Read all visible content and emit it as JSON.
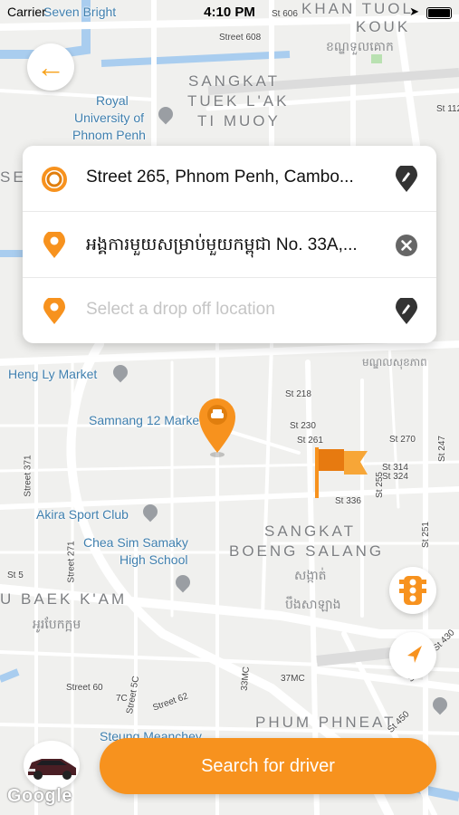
{
  "status_bar": {
    "carrier": "Carrier",
    "time": "4:10 PM"
  },
  "map": {
    "labels": {
      "seven_bright": "Seven Bright",
      "royal_university_line1": "Royal",
      "royal_university_line2": "University of",
      "royal_university_line3": "Phnom Penh",
      "heng_ly_market": "Heng Ly Market",
      "samnang_market": "Samnang 12 Market",
      "akira_sport_club": "Akira Sport Club",
      "chea_sim_line1": "Chea Sim Samaky",
      "chea_sim_line2": "High School",
      "steung_meanchey": "Steung Meanchey"
    },
    "areas": {
      "khan_tuol_kouk_line1": "KHAN TUOL",
      "khan_tuol_kouk_line2": "KOUK",
      "tuek_lak_line1": "SANGKAT",
      "tuek_lak_line2": "TUEK L'AK",
      "tuek_lak_line3": "TI MUOY",
      "boeng_salang_line1": "SANGKAT",
      "boeng_salang_line2": "BOENG SALANG",
      "baek_kam": "U BAEK K'AM",
      "phum_phneat": "PHUM PHNEAT",
      "se_fragment": "SE"
    },
    "khmer": {
      "tuol_kouk": "ខណ្ឌទួលគោក",
      "boeng_salang_line1": "សង្កាត់",
      "boeng_salang_line2": "បឹងសាឡាង",
      "baek_kam": "អូរបែកក្អម",
      "right_edge": "មណ្ឌលសុខភាព"
    },
    "streets": [
      "St 606",
      "Street 608",
      "St 112",
      "St 218",
      "St 230",
      "St 261",
      "St 270",
      "St 314",
      "St 324",
      "St 336",
      "St 255",
      "St 247",
      "Street 371",
      "Street 271",
      "St 251",
      "Street 5C",
      "Street 62",
      "33MC",
      "37MC",
      "7C",
      "Street 60",
      "St 430",
      "St 207",
      "St 450",
      "St 5"
    ]
  },
  "location_card": {
    "pickup_text": "Street 265, Phnom Penh, Cambo...",
    "stop_text": "អង្គការមួយសម្រាប់មួយកម្ពុជា No. 33A,...",
    "dropoff_placeholder": "Select a drop off location",
    "icons": {
      "pickup": "pickup-ring-icon",
      "stop": "location-pin-icon",
      "dropoff": "location-pin-icon",
      "pickup_action": "map-pin-picker-icon",
      "stop_action": "clear-icon",
      "dropoff_action": "map-pin-picker-icon"
    }
  },
  "buttons": {
    "search_label": "Search for driver"
  },
  "brand": {
    "google": "Google"
  },
  "colors": {
    "accent": "#f7921e",
    "accent_light": "#f7a21b",
    "map_label": "#3f7fae"
  }
}
